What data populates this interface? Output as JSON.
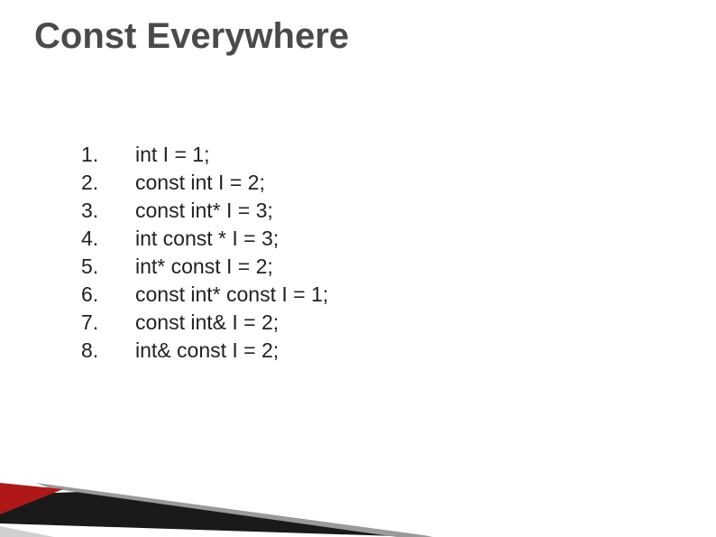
{
  "title": "Const Everywhere",
  "items": [
    {
      "num": "1.",
      "text": "int I = 1;"
    },
    {
      "num": "2.",
      "text": "const int I = 2;"
    },
    {
      "num": "3.",
      "text": "const int* I = 3;"
    },
    {
      "num": "4.",
      "text": "int const * I = 3;"
    },
    {
      "num": "5.",
      "text": "int* const I = 2;"
    },
    {
      "num": "6.",
      "text": "const int* const I = 1;"
    },
    {
      "num": "7.",
      "text": "const int& I = 2;"
    },
    {
      "num": "8.",
      "text": "int& const I = 2;"
    }
  ]
}
